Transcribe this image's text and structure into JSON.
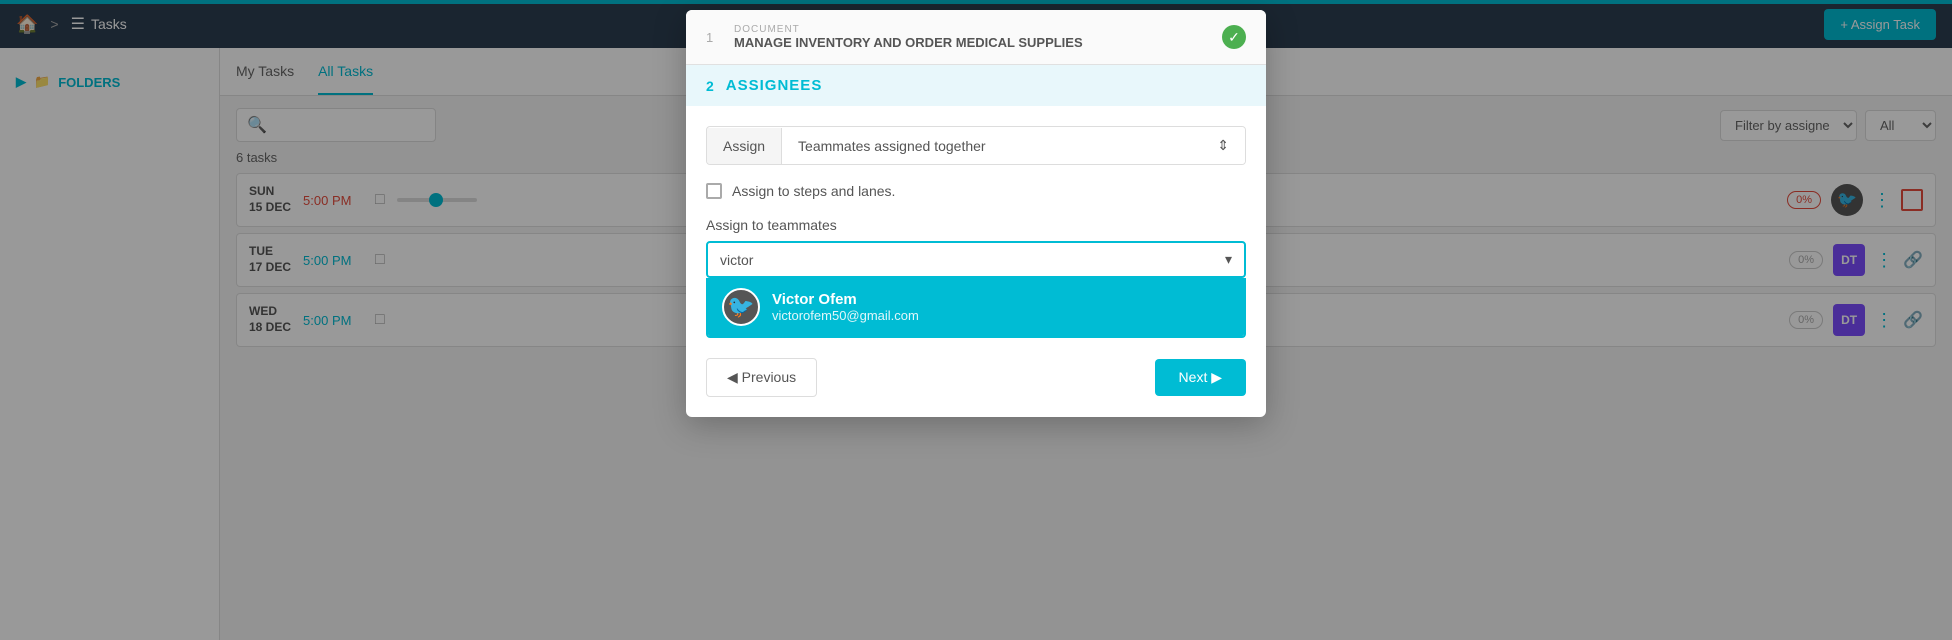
{
  "topnav": {
    "home_icon": "🏠",
    "breadcrumb_sep": ">",
    "tasks_label": "Tasks",
    "assign_task_btn": "+ Assign Task"
  },
  "sidebar": {
    "folders_label": "FOLDERS"
  },
  "tabs": {
    "my_tasks": "My Tasks",
    "all_tasks": "All Tasks"
  },
  "content": {
    "tasks_count": "6 tasks",
    "filter_placeholder": "Filter by assigne",
    "all_option": "All"
  },
  "task_rows": [
    {
      "day": "SUN",
      "date": "15 DEC",
      "time": "5:00 PM",
      "time_color": "red",
      "progress": "0%",
      "avatar_type": "bird"
    },
    {
      "day": "TUE",
      "date": "17 DEC",
      "time": "5:00 PM",
      "time_color": "teal",
      "progress": "0%",
      "avatar_type": "dt"
    },
    {
      "day": "WED",
      "date": "18 DEC",
      "time": "5:00 PM",
      "time_color": "teal",
      "progress": "0%",
      "avatar_type": "dt"
    }
  ],
  "modal": {
    "step1": {
      "number": "1",
      "label": "DOCUMENT",
      "title": "MANAGE INVENTORY AND ORDER MEDICAL SUPPLIES",
      "check": "✓"
    },
    "step2": {
      "number": "2",
      "label": "ASSIGNEES"
    },
    "assign_label": "Assign",
    "assign_select_value": "Teammates assigned together",
    "assign_select_arrows": "⇕",
    "checkbox_label": "Assign to steps and lanes.",
    "teammates_label": "Assign to teammates",
    "search_value": "victor",
    "dropdown_arrow": "▾",
    "result": {
      "name": "Victor Ofem",
      "email": "victorofem50@gmail.com",
      "avatar_icon": "🐦"
    },
    "btn_previous": "◀ Previous",
    "btn_next": "Next ▶"
  }
}
